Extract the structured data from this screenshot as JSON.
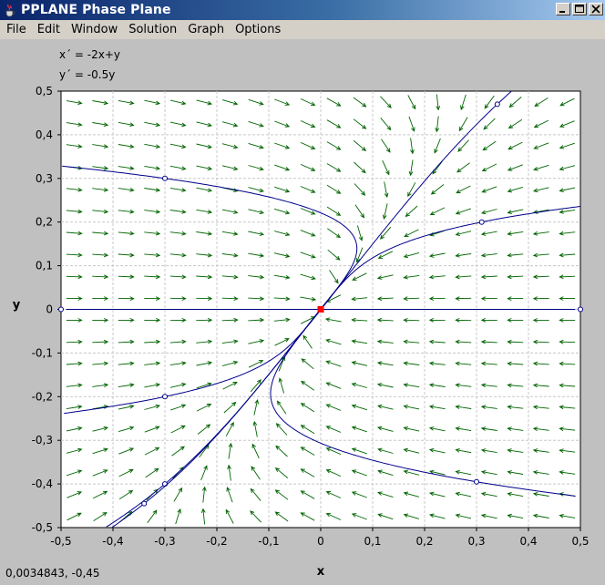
{
  "window": {
    "title": "PPLANE Phase Plane",
    "app_icon": "java-cup-icon",
    "controls": [
      "minimize",
      "maximize",
      "close"
    ]
  },
  "menu": {
    "items": [
      "File",
      "Edit",
      "Window",
      "Solution",
      "Graph",
      "Options"
    ]
  },
  "equations": {
    "x_prime": "x´ = -2x+y",
    "y_prime": "y´ = -0.5y"
  },
  "status": {
    "coordinates": "0,0034843,  -0,45"
  },
  "colors": {
    "field_arrows": "#006400",
    "trajectories": "#00008b",
    "equilibrium": "#ff0000",
    "grid": "#c8c8c8",
    "plot_background": "#ffffff"
  },
  "chart_data": {
    "type": "phase-plane",
    "xlabel": "x",
    "ylabel": "y",
    "xlim": [
      -0.5,
      0.5
    ],
    "ylim": [
      -0.5,
      0.5
    ],
    "x_ticks": [
      "-0,5",
      "-0,4",
      "-0,3",
      "-0,2",
      "-0,1",
      "0",
      "0,1",
      "0,2",
      "0,3",
      "0,4",
      "0,5"
    ],
    "y_ticks": [
      "-0,5",
      "-0,4",
      "-0,3",
      "-0,2",
      "-0,1",
      "0",
      "0,1",
      "0,2",
      "0,3",
      "0,4",
      "0,5"
    ],
    "grid": true,
    "equilibrium": {
      "x": 0,
      "y": 0
    },
    "trajectory_initial_points": [
      {
        "x": -0.3,
        "y": 0.3
      },
      {
        "x": 0.34,
        "y": 0.47
      },
      {
        "x": 0.31,
        "y": 0.2
      },
      {
        "x": -0.3,
        "y": -0.2
      },
      {
        "x": -0.3,
        "y": -0.4
      },
      {
        "x": -0.34,
        "y": -0.445
      },
      {
        "x": 0.3,
        "y": -0.395
      },
      {
        "x": -0.5,
        "y": 0
      },
      {
        "x": 0.5,
        "y": 0
      }
    ]
  }
}
